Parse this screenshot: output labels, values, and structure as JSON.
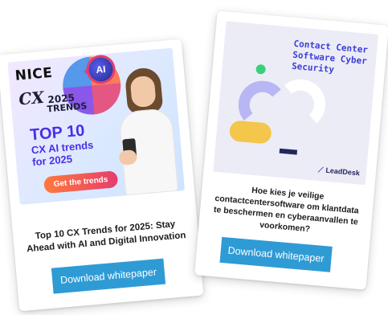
{
  "left_card": {
    "hero": {
      "logo": "NICE",
      "ai_badge": "AI",
      "cx_mark": "CX",
      "cx_year": "2025",
      "cx_word": "TRENDS",
      "headline_big": "TOP 10",
      "headline_line2": "CX AI trends",
      "headline_line3": "for 2025",
      "cta_label": "Get the trends"
    },
    "title": "Top 10 CX Trends for 2025: Stay Ahead with AI and Digital Innovation",
    "button_label": "Download whitepaper"
  },
  "right_card": {
    "hero": {
      "title": "Contact Center Software Cyber Security",
      "logo": "LeadDesk"
    },
    "title": "Hoe kies je veilige contactcentersoftware om klantdata te beschermen en cyberaanvallen te voorkomen?",
    "button_label": "Download whitepaper"
  },
  "colors": {
    "button_blue": "#2f9bd5",
    "nice_purple": "#4a2ee6",
    "leaddesk_blue": "#3b3fd8",
    "accent_yellow": "#f4c64b",
    "accent_green": "#3ad07a"
  }
}
